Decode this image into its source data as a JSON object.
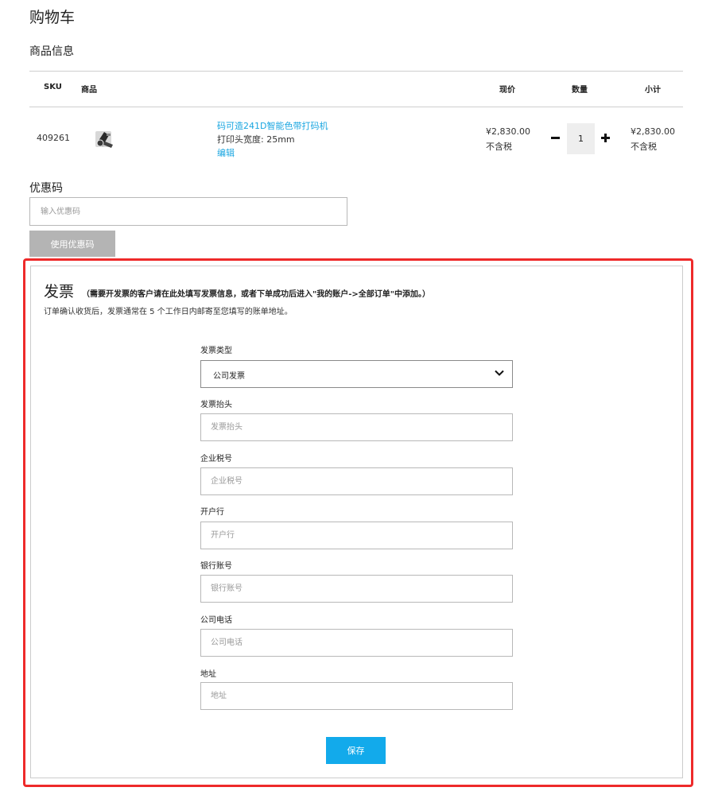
{
  "page": {
    "title": "购物车",
    "section_title": "商品信息"
  },
  "table": {
    "headers": {
      "sku": "SKU",
      "product": "商品",
      "price": "现价",
      "qty": "数量",
      "subtotal": "小计"
    },
    "row": {
      "sku": "409261",
      "thumb_icon": "label-printer-icon",
      "name": "码可造241D智能色带打码机",
      "option": "打印头宽度: 25mm",
      "edit_label": "编辑",
      "price": "¥2,830.00",
      "price_tax": "不含税",
      "qty": "1",
      "subtotal": "¥2,830.00",
      "subtotal_tax": "不含税"
    }
  },
  "coupon": {
    "label": "优惠码",
    "placeholder": "输入优惠码",
    "button": "使用优惠码"
  },
  "invoice": {
    "title": "发票",
    "note": "（需要开发票的客户请在此处填写发票信息，或者下单成功后进入\"我的账户->全部订单\"中添加。）",
    "description": "订单确认收货后，发票通常在 5 个工作日内邮寄至您填写的账单地址。",
    "type_label": "发票类型",
    "type_value": "公司发票",
    "fields": [
      {
        "label": "发票抬头",
        "placeholder": "发票抬头"
      },
      {
        "label": "企业税号",
        "placeholder": "企业税号"
      },
      {
        "label": "开户行",
        "placeholder": "开户行"
      },
      {
        "label": "银行账号",
        "placeholder": "银行账号"
      },
      {
        "label": "公司电话",
        "placeholder": "公司电话"
      },
      {
        "label": "地址",
        "placeholder": "地址"
      }
    ],
    "save_button": "保存"
  },
  "colors": {
    "accent": "#12aaeb",
    "link": "#1aa6e0",
    "highlight_frame": "#ee2a2a",
    "disabled_button": "#b4b4b4"
  }
}
